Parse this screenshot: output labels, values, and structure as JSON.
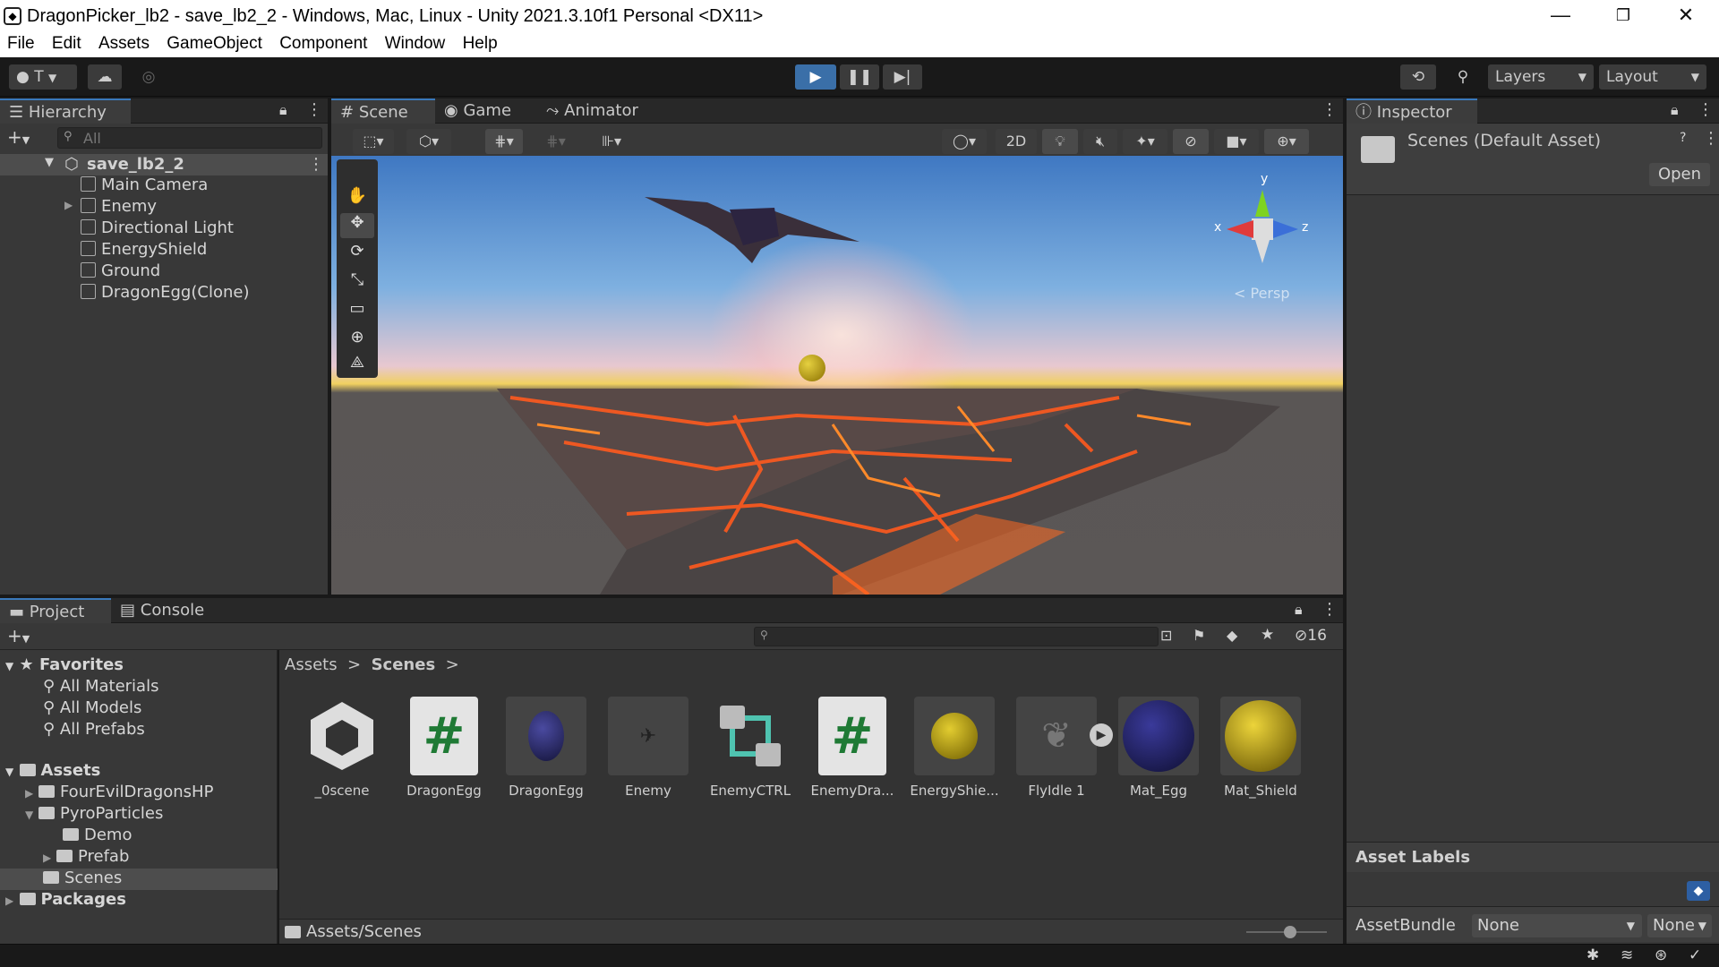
{
  "window": {
    "title": "DragonPicker_lb2 - save_lb2_2 - Windows, Mac, Linux - Unity 2021.3.10f1 Personal <DX11>",
    "minimize_icon": "minimize-icon",
    "maximize_icon": "restore-icon",
    "close_icon": "close-icon"
  },
  "menu": [
    "File",
    "Edit",
    "Assets",
    "GameObject",
    "Component",
    "Window",
    "Help"
  ],
  "toolbar": {
    "account_label": "T",
    "layers_label": "Layers",
    "layout_label": "Layout",
    "play_active": true
  },
  "hierarchy": {
    "tab_label": "Hierarchy",
    "search_placeholder": "All",
    "scene_name": "save_lb2_2",
    "items": [
      "Main Camera",
      "Enemy",
      "Directional Light",
      "EnergyShield",
      "Ground",
      "DragonEgg(Clone)"
    ]
  },
  "scene_tabs": [
    "Scene",
    "Game",
    "Animator"
  ],
  "scene_view": {
    "mode_2d_label": "2D",
    "gizmo_x": "x",
    "gizmo_y": "y",
    "gizmo_z": "z",
    "persp_label": "< Persp"
  },
  "inspector": {
    "tab_label": "Inspector",
    "asset_title": "Scenes (Default Asset)",
    "open_label": "Open",
    "asset_labels_title": "Asset Labels",
    "assetbundle_label": "AssetBundle",
    "assetbundle_value": "None",
    "variant_value": "None"
  },
  "project": {
    "tabs": [
      "Project",
      "Console"
    ],
    "hidden_count": "16",
    "favorites_label": "Favorites",
    "favorites": [
      "All Materials",
      "All Models",
      "All Prefabs"
    ],
    "assets_label": "Assets",
    "folders": [
      "FourEvilDragonsHP",
      "PyroParticles",
      "Demo",
      "Prefab",
      "Scenes"
    ],
    "packages_label": "Packages",
    "breadcrumb": [
      "Assets",
      "Scenes"
    ],
    "assets": [
      {
        "name": "_0scene",
        "icon": "unity-scene-icon"
      },
      {
        "name": "DragonEgg",
        "icon": "script-icon"
      },
      {
        "name": "DragonEgg",
        "icon": "material-egg-icon"
      },
      {
        "name": "Enemy",
        "icon": "prefab-dragon-icon"
      },
      {
        "name": "EnemyCTRL",
        "icon": "animator-controller-icon"
      },
      {
        "name": "EnemyDra...",
        "icon": "script-icon"
      },
      {
        "name": "EnergyShie...",
        "icon": "sphere-prefab-icon"
      },
      {
        "name": "FlyIdle 1",
        "icon": "animation-clip-icon"
      },
      {
        "name": "Mat_Egg",
        "icon": "material-sphere-icon"
      },
      {
        "name": "Mat_Shield",
        "icon": "material-sphere-icon"
      }
    ],
    "footer_path": "Assets/Scenes"
  },
  "colors": {
    "accent": "#3a79bb",
    "egg_blue": "#2a2a6a",
    "shield_gold": "#c8a80c"
  }
}
